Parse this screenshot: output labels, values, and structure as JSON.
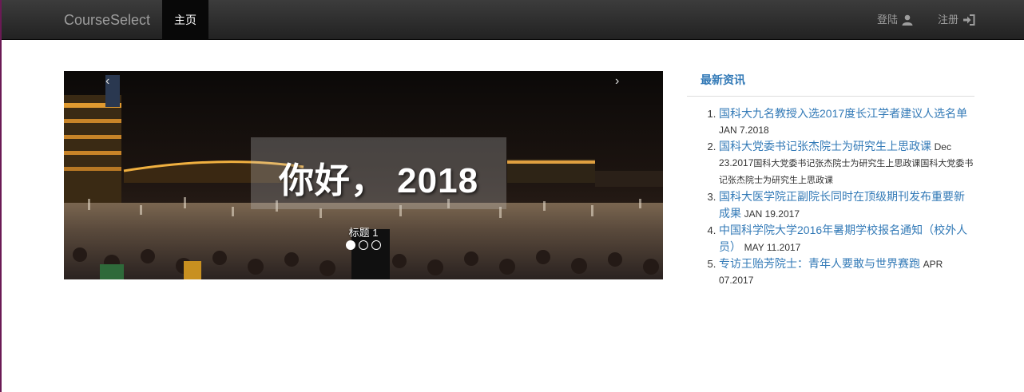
{
  "navbar": {
    "brand": "CourseSelect",
    "active_item": "主页",
    "login": "登陆",
    "register": "注册"
  },
  "carousel": {
    "image_text": "你好， 2018",
    "slide_title": "标题 1",
    "prev_arrow": "‹",
    "next_arrow": "›",
    "indicator_count": 3,
    "active_indicator": 0
  },
  "news": {
    "heading": "最新资讯",
    "items": [
      {
        "number": "1.",
        "title": "国科大九名教授入选2017度长江学者建议人选名单",
        "date": "JAN 7.2018",
        "desc": ""
      },
      {
        "number": "2.",
        "title": "国科大党委书记张杰院士为研究生上思政课",
        "date": "Dec 23.2017",
        "desc": "国科大党委书记张杰院士为研究生上思政课国科大党委书记张杰院士为研究生上思政课"
      },
      {
        "number": "3.",
        "title": "国科大医学院正副院长同时在顶级期刊发布重要新成果",
        "date": "JAN 19.2017",
        "desc": ""
      },
      {
        "number": "4.",
        "title": "中国科学院大学2016年暑期学校报名通知（校外人员）",
        "date": "MAY 11.2017",
        "desc": ""
      },
      {
        "number": "5.",
        "title": "专访王贻芳院士：青年人要敢与世界赛跑",
        "date": "APR 07.2017",
        "desc": ""
      }
    ]
  }
}
